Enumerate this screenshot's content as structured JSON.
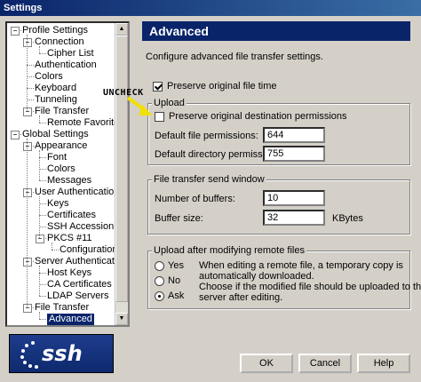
{
  "window": {
    "title": "Settings"
  },
  "tree": {
    "items": [
      {
        "label": "Profile Settings",
        "depth": 0,
        "expanded": true
      },
      {
        "label": "Connection",
        "depth": 1,
        "expanded": true
      },
      {
        "label": "Cipher List",
        "depth": 2
      },
      {
        "label": "Authentication",
        "depth": 1
      },
      {
        "label": "Colors",
        "depth": 1
      },
      {
        "label": "Keyboard",
        "depth": 1
      },
      {
        "label": "Tunneling",
        "depth": 1
      },
      {
        "label": "File Transfer",
        "depth": 1,
        "expanded": true
      },
      {
        "label": "Remote Favorites",
        "depth": 2
      },
      {
        "label": "Global Settings",
        "depth": 0,
        "expanded": true
      },
      {
        "label": "Appearance",
        "depth": 1,
        "expanded": true
      },
      {
        "label": "Font",
        "depth": 2
      },
      {
        "label": "Colors",
        "depth": 2
      },
      {
        "label": "Messages",
        "depth": 2
      },
      {
        "label": "User Authentication",
        "depth": 1,
        "expanded": true
      },
      {
        "label": "Keys",
        "depth": 2
      },
      {
        "label": "Certificates",
        "depth": 2
      },
      {
        "label": "SSH Accession",
        "depth": 2
      },
      {
        "label": "PKCS #11",
        "depth": 2,
        "expanded": true
      },
      {
        "label": "Configuration",
        "depth": 3
      },
      {
        "label": "Server Authentication",
        "depth": 1,
        "expanded": true
      },
      {
        "label": "Host Keys",
        "depth": 2
      },
      {
        "label": "CA Certificates",
        "depth": 2
      },
      {
        "label": "LDAP Servers",
        "depth": 2
      },
      {
        "label": "File Transfer",
        "depth": 1,
        "expanded": true
      },
      {
        "label": "Advanced",
        "depth": 2,
        "selected": true
      }
    ]
  },
  "panel": {
    "title": "Advanced",
    "description": "Configure advanced file transfer settings.",
    "preserve_time_label": "Preserve original file time",
    "preserve_time_checked": true
  },
  "upload": {
    "legend": "Upload",
    "preserve_perms_label": "Preserve original destination permissions",
    "preserve_perms_checked": false,
    "file_perm_label": "Default file permissions:",
    "file_perm_value": "644",
    "dir_perm_label": "Default directory permissions:",
    "dir_perm_value": "755"
  },
  "send_window": {
    "legend": "File transfer send window",
    "buffers_label": "Number of buffers:",
    "buffers_value": "10",
    "buffer_size_label": "Buffer size:",
    "buffer_size_value": "32",
    "buffer_size_unit": "KBytes"
  },
  "after_modify": {
    "legend": "Upload after modifying remote files",
    "options": [
      "Yes",
      "No",
      "Ask"
    ],
    "selected": "Ask",
    "help_text_1": "When editing a remote file, a temporary copy is",
    "help_text_2": "automatically downloaded.",
    "help_text_3": "Choose if the modified file should be uploaded to the",
    "help_text_4": "server after editing."
  },
  "annotation": {
    "text": "UNCHECK",
    "color": "#f0e000"
  },
  "logo": {
    "text": "ssh"
  },
  "buttons": {
    "ok": "OK",
    "cancel": "Cancel",
    "help": "Help"
  },
  "colors": {
    "header_bg": "#0a246a",
    "face": "#d4d0c8"
  }
}
